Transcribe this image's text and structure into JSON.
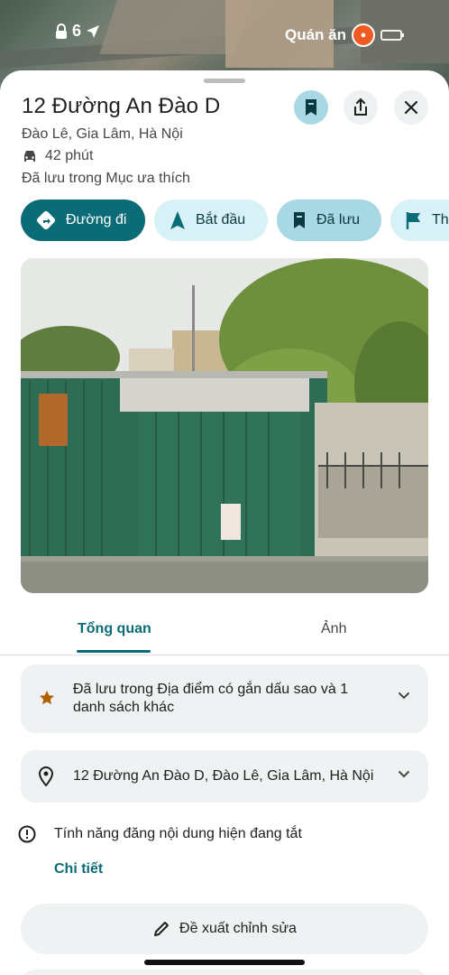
{
  "status_bar": {
    "time": "6",
    "app_label": "Quán ăn"
  },
  "place": {
    "title": "12 Đường An Đào D",
    "address_line": "Đào Lê, Gia Lâm, Hà Nội",
    "drive_time": "42 phút",
    "saved_note": "Đã lưu trong Mục ưa thích"
  },
  "chips": {
    "directions": "Đường đi",
    "start": "Bắt đầu",
    "saved": "Đã lưu",
    "more": "Th"
  },
  "tabs": {
    "overview": "Tổng quan",
    "photos": "Ảnh"
  },
  "saved_card": {
    "text": "Đã lưu trong Địa điểm có gắn dấu sao và 1 danh sách khác"
  },
  "address_card": {
    "text": "12 Đường An Đào D, Đào Lê, Gia Lâm, Hà Nội"
  },
  "notice": {
    "text": "Tính năng đăng nội dung hiện đang tắt",
    "link": "Chi tiết"
  },
  "suggest": {
    "label": "Đề xuất chỉnh sửa"
  },
  "icons": [
    "navigation-icon",
    "bookmark-icon",
    "share-icon",
    "close-icon",
    "car-icon",
    "directions-icon",
    "start-arrow-icon",
    "flag-icon",
    "star-icon",
    "location-pin-icon",
    "chevron-down-icon",
    "info-icon",
    "edit-pencil-icon"
  ],
  "colors": {
    "accent": "#0b6b76",
    "chip_light": "#d8f1f6",
    "chip_selected": "#a8d8e4",
    "card_bg": "#eef2f3",
    "star": "#b06000"
  }
}
